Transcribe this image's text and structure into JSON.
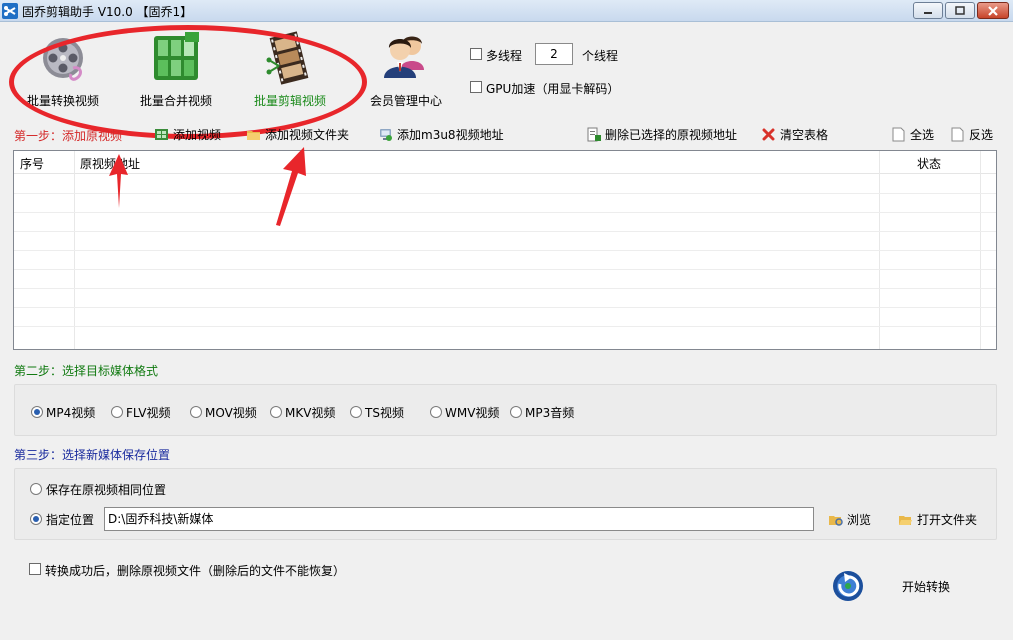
{
  "window": {
    "title": "固乔剪辑助手 V10.0  【固乔1】"
  },
  "toolbar": {
    "tools": [
      {
        "label": "批量转换视频",
        "icon": "film-reel-icon"
      },
      {
        "label": "批量合并视频",
        "icon": "merge-grid-icon"
      },
      {
        "label": "批量剪辑视频",
        "icon": "film-strip-icon"
      },
      {
        "label": "会员管理中心",
        "icon": "users-icon"
      }
    ],
    "multithread_label": "多线程",
    "thread_count": "2",
    "thread_unit": "个线程",
    "gpu_label": "GPU加速（用显卡解码）"
  },
  "step1": {
    "label": "第一步：添加原视频",
    "actions": [
      {
        "label": "添加视频",
        "icon": "add-video-icon"
      },
      {
        "label": "添加视频文件夹",
        "icon": "folder-icon"
      },
      {
        "label": "添加m3u8视频地址",
        "icon": "link-icon"
      },
      {
        "label": "删除已选择的原视频地址",
        "icon": "delete-file-icon"
      },
      {
        "label": "清空表格",
        "icon": "red-x-icon"
      },
      {
        "label": "全选",
        "icon": "page-icon"
      },
      {
        "label": "反选",
        "icon": "page-icon"
      }
    ]
  },
  "table": {
    "columns": [
      "序号",
      "原视频地址",
      "状态"
    ],
    "rows": []
  },
  "step2": {
    "label": "第二步：选择目标媒体格式",
    "formats": [
      "MP4视频",
      "FLV视频",
      "MOV视频",
      "MKV视频",
      "TS视频",
      "WMV视频",
      "MP3音频"
    ],
    "selected": "MP4视频"
  },
  "step3": {
    "label": "第三步：选择新媒体保存位置",
    "option_same": "保存在原视频相同位置",
    "option_custom": "指定位置",
    "path": "D:\\固乔科技\\新媒体",
    "browse": "浏览",
    "open_folder": "打开文件夹"
  },
  "footer": {
    "delete_after_label": "转换成功后，删除原视频文件（删除后的文件不能恢复）",
    "start_label": "开始转换"
  },
  "colors": {
    "annotation_red": "#e8262b",
    "step1_red": "#d42a2a",
    "step2_green": "#117a11",
    "step3_blue": "#1a2b9e",
    "active_tool_green": "#1a8a1a"
  }
}
